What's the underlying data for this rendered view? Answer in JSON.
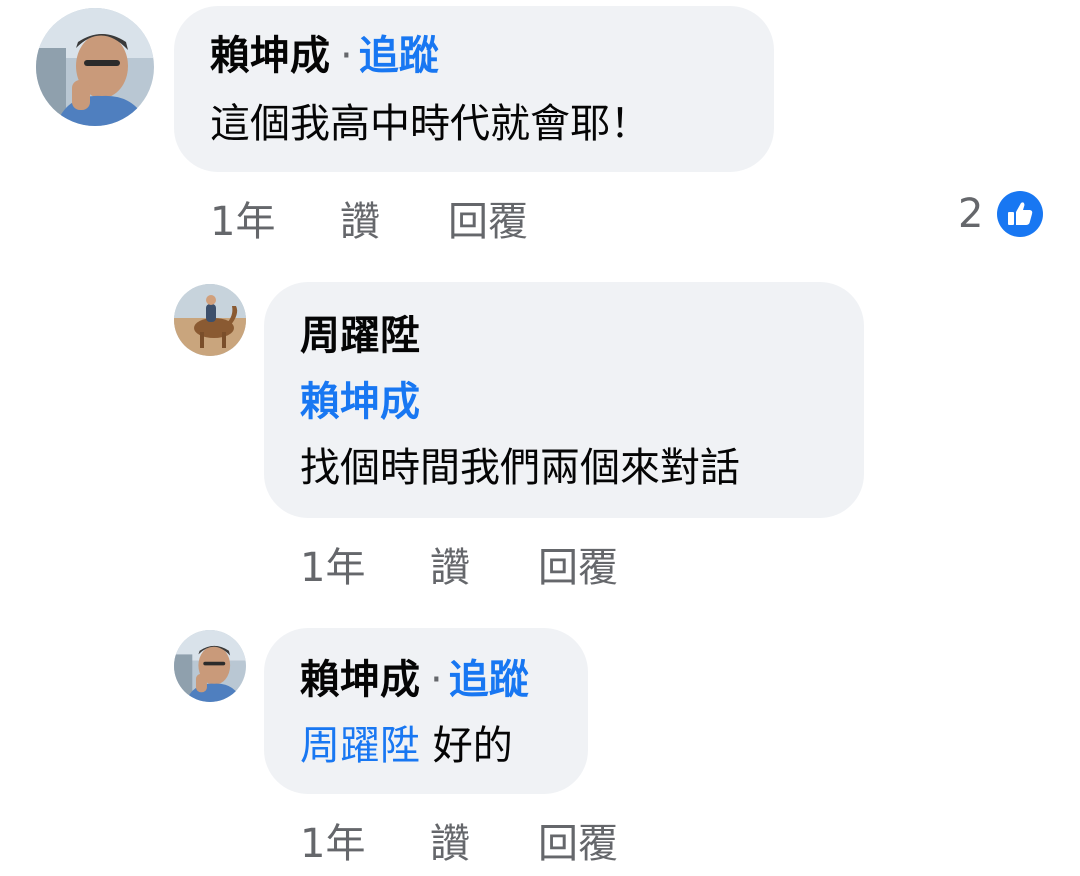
{
  "comments": [
    {
      "author": "賴坤成",
      "separator": "·",
      "follow_label": "追蹤",
      "text": "這個我高中時代就會耶！",
      "time": "1年",
      "like_label": "讚",
      "reply_label": "回覆",
      "reaction_count": "2",
      "reaction_icon": "like-thumbs-up-icon"
    },
    {
      "author": "周躍陞",
      "mention": "賴坤成",
      "text": "找個時間我們兩個來對話",
      "time": "1年",
      "like_label": "讚",
      "reply_label": "回覆"
    },
    {
      "author": "賴坤成",
      "separator": "·",
      "follow_label": "追蹤",
      "mention": "周躍陞",
      "text": "好的",
      "time": "1年",
      "like_label": "讚",
      "reply_label": "回覆"
    }
  ],
  "colors": {
    "bubble": "#f0f2f5",
    "link": "#1877f2",
    "meta": "#65676b",
    "text": "#050505"
  }
}
